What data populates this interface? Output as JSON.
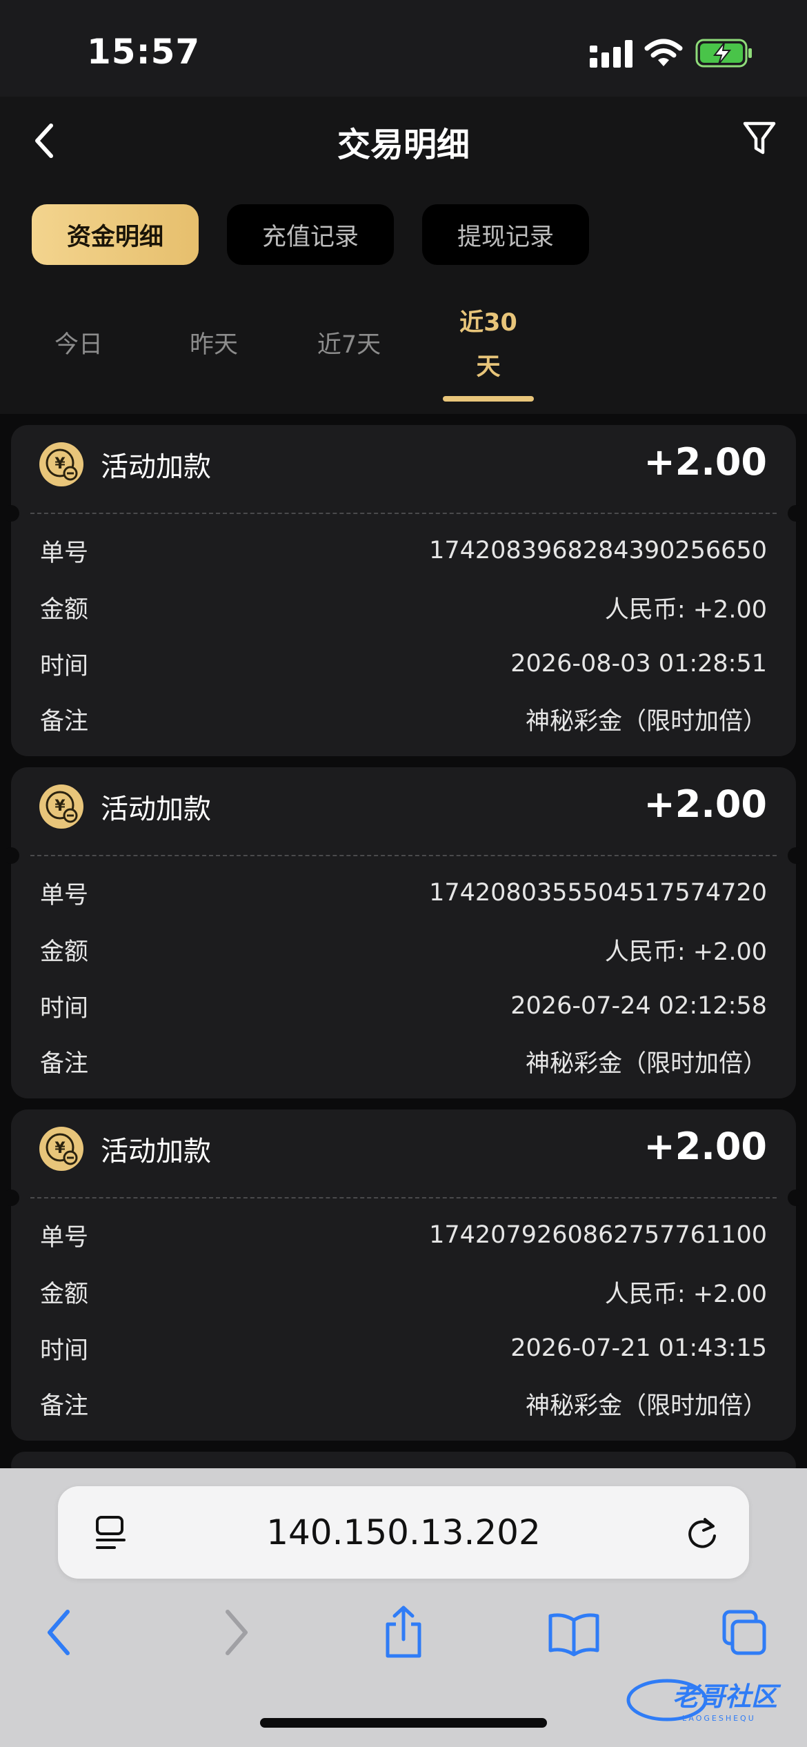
{
  "status": {
    "time": "15:57"
  },
  "header": {
    "title": "交易明细"
  },
  "tabs": [
    {
      "label": "资金明细",
      "active": true
    },
    {
      "label": "充值记录",
      "active": false
    },
    {
      "label": "提现记录",
      "active": false
    }
  ],
  "periods": [
    {
      "label": "今日",
      "active": false
    },
    {
      "label": "昨天",
      "active": false
    },
    {
      "label": "近7天",
      "active": false
    },
    {
      "label_line1": "近30",
      "label_line2": "天",
      "active": true
    }
  ],
  "row_labels": {
    "order": "单号",
    "amount": "金额",
    "time": "时间",
    "remark": "备注"
  },
  "transactions": [
    {
      "type": "活动加款",
      "amount": "+2.00",
      "order": "1742083968284390256650",
      "amount_detail": "人民币: +2.00",
      "time": "2026-08-03 01:28:51",
      "remark": "神秘彩金（限时加倍）"
    },
    {
      "type": "活动加款",
      "amount": "+2.00",
      "order": "1742080355504517574720",
      "amount_detail": "人民币: +2.00",
      "time": "2026-07-24 02:12:58",
      "remark": "神秘彩金（限时加倍）"
    },
    {
      "type": "活动加款",
      "amount": "+2.00",
      "order": "1742079260862757761100",
      "amount_detail": "人民币: +2.00",
      "time": "2026-07-21 01:43:15",
      "remark": "神秘彩金（限时加倍）"
    }
  ],
  "browser": {
    "url": "140.150.13.202"
  },
  "watermark": {
    "text": "老哥社区",
    "sub": "LAOGESHEQU"
  },
  "colors": {
    "accent": "#e8c57a",
    "card": "#1c1c1e",
    "ios_blue": "#2f7cf6"
  }
}
